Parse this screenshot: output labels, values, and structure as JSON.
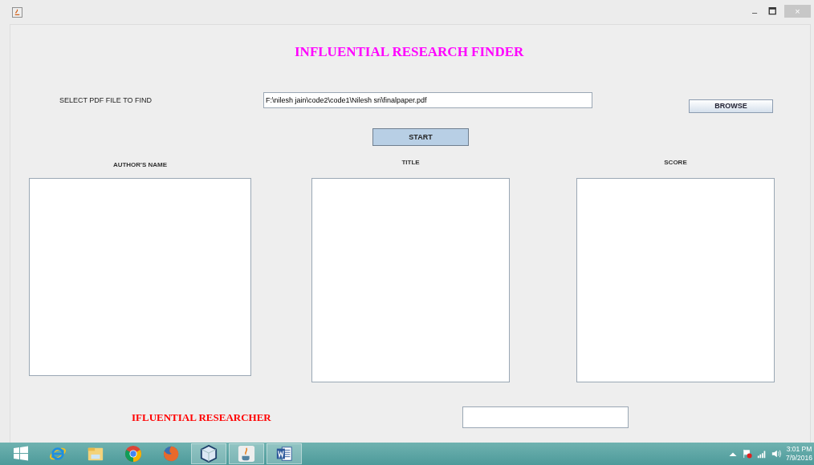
{
  "window": {
    "title_bar_buttons": [
      "–",
      "🗖",
      "×"
    ]
  },
  "heading": "INFLUENTIAL RESEARCH FINDER",
  "file_row": {
    "label": "SELECT PDF FILE  TO FIND",
    "value": "F:\\nilesh jain\\code2\\code1\\Nilesh sri\\finalpaper.pdf",
    "browse_button": "BROWSE"
  },
  "start_button": "START",
  "columns": [
    {
      "header": "AUTHOR'S NAME"
    },
    {
      "header": "TITLE"
    },
    {
      "header": "SCORE"
    }
  ],
  "result": {
    "label": "IFLUENTIAL RESEARCHER"
  },
  "taskbar": {
    "apps": [
      {
        "kind": "ie",
        "selected": false
      },
      {
        "kind": "folder",
        "selected": false
      },
      {
        "kind": "chrome",
        "selected": false
      },
      {
        "kind": "firefox",
        "selected": false
      },
      {
        "kind": "cube",
        "selected": true
      },
      {
        "kind": "java",
        "selected": true
      },
      {
        "kind": "word",
        "selected": true
      }
    ],
    "time": "3:01 PM",
    "date": "7/9/2016"
  }
}
